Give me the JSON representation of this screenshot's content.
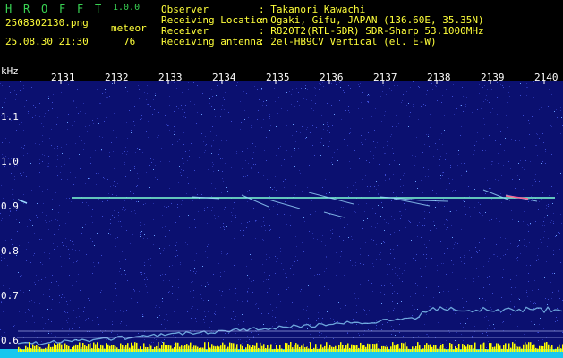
{
  "app": {
    "title_letters": [
      "H",
      "R",
      "O",
      "F",
      "F",
      "T"
    ],
    "version": "1.0.0"
  },
  "file": {
    "name": "2508302130.png",
    "datetime": "25.08.30 21:30",
    "meteor_label": "meteor",
    "meteor_count": "76"
  },
  "info": [
    {
      "label": "Observer",
      "value": ": Takanori Kawachi"
    },
    {
      "label": "Receiving Location",
      "value": ": Ogaki, Gifu, JAPAN (136.60E, 35.35N)"
    },
    {
      "label": "Receiver",
      "value": ": R820T2(RTL-SDR) SDR-Sharp 53.1000MHz"
    },
    {
      "label": "Receiving antenna",
      "value": ": 2el-HB9CV Vertical (el. E-W)"
    }
  ],
  "axes": {
    "y_unit": "kHz",
    "x_ticks": [
      "2131",
      "2132",
      "2133",
      "2134",
      "2135",
      "2136",
      "2137",
      "2138",
      "2139",
      "2140"
    ],
    "y_ticks": [
      "1.1",
      "1.0",
      "0.9",
      "0.8",
      "0.7",
      "0.6"
    ]
  },
  "colors": {
    "background": "#000000",
    "spectrogram_bg": "#0b1070",
    "noise": "#3a4ad0",
    "carrier": "#7fffd4",
    "title_green": "#39d353",
    "label_yellow": "#ffff3a",
    "floor_cyan": "#17c7ee",
    "floor_yellow": "#ffff00"
  }
}
